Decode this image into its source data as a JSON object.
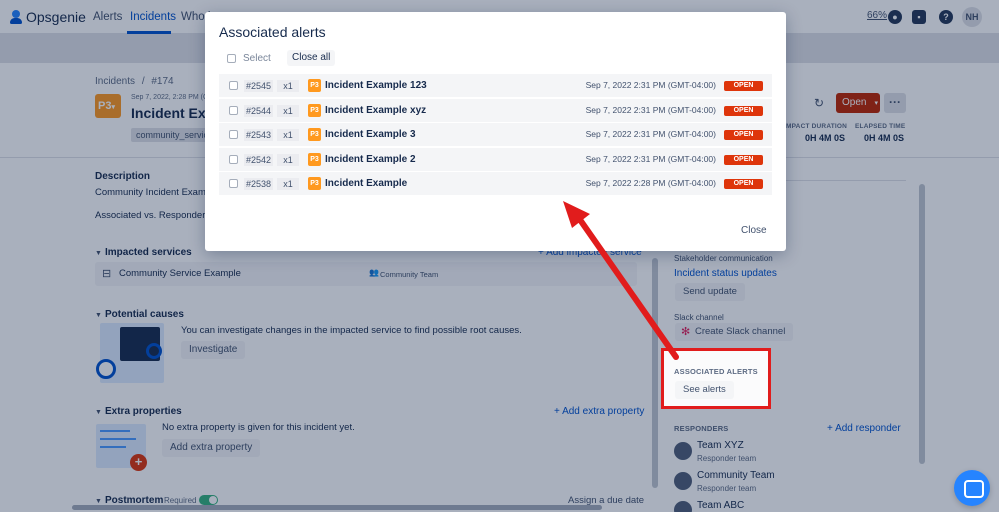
{
  "app": {
    "name": "Opsgenie",
    "nav": [
      "Alerts",
      "Incidents",
      "Who is"
    ],
    "zoom": "66%",
    "user_initials": "NH"
  },
  "incident": {
    "breadcrumbs": [
      "Incidents",
      "/",
      "#174"
    ],
    "priority": "P3",
    "date": "Sep 7, 2022, 2:28 PM (G",
    "title": "Incident Example",
    "service_tag": "community_servic",
    "status_button": "Open",
    "stats": {
      "impact_duration_label": "IMPACT DURATION",
      "impact_duration_value": "0H 4M 0S",
      "elapsed_time_label": "ELAPSED TIME",
      "elapsed_time_value": "0H 4M 0S"
    }
  },
  "main": {
    "description_heading": "Description",
    "description_text": "Community Incident Example",
    "associated_text": "Associated vs. Responder ale",
    "impacted_services": {
      "heading": "Impacted services",
      "add_label": "Add impacted service",
      "service_name": "Community Service Example",
      "team_name": "Community Team"
    },
    "potential_causes": {
      "heading": "Potential causes",
      "text": "You can investigate changes in the impacted service to find possible root causes.",
      "button": "Investigate"
    },
    "extra_properties": {
      "heading": "Extra properties",
      "add_label": "Add extra property",
      "text": "No extra property is given for this incident yet.",
      "button": "Add extra property"
    },
    "postmortem": {
      "heading": "Postmortem",
      "required_label": "Required",
      "due_label": "Assign a due date"
    }
  },
  "right_panel": {
    "stakeholder_label": "Stakeholder communication",
    "status_updates_link": "Incident status updates",
    "send_update_button": "Send update",
    "slack_label": "Slack channel",
    "create_slack_button": "Create Slack channel",
    "associated_alerts_heading": "ASSOCIATED ALERTS",
    "see_alerts_button": "See alerts",
    "responders_heading": "RESPONDERS",
    "add_responder_label": "Add responder",
    "responders": [
      {
        "name": "Team XYZ",
        "role": "Responder team"
      },
      {
        "name": "Community Team",
        "role": "Responder team"
      },
      {
        "name": "Team ABC",
        "role": ""
      }
    ]
  },
  "modal": {
    "title": "Associated alerts",
    "select_label": "Select",
    "close_all_button": "Close all",
    "close_button": "Close",
    "alerts": [
      {
        "id": "#2545",
        "count": "x1",
        "priority": "P3",
        "title": "Incident Example 123",
        "date": "Sep 7, 2022 2:31 PM (GMT-04:00)",
        "status": "OPEN"
      },
      {
        "id": "#2544",
        "count": "x1",
        "priority": "P3",
        "title": "Incident Example xyz",
        "date": "Sep 7, 2022 2:31 PM (GMT-04:00)",
        "status": "OPEN"
      },
      {
        "id": "#2543",
        "count": "x1",
        "priority": "P3",
        "title": "Incident Example 3",
        "date": "Sep 7, 2022 2:31 PM (GMT-04:00)",
        "status": "OPEN"
      },
      {
        "id": "#2542",
        "count": "x1",
        "priority": "P3",
        "title": "Incident Example 2",
        "date": "Sep 7, 2022 2:31 PM (GMT-04:00)",
        "status": "OPEN"
      },
      {
        "id": "#2538",
        "count": "x1",
        "priority": "P3",
        "title": "Incident Example",
        "date": "Sep 7, 2022 2:28 PM (GMT-04:00)",
        "status": "OPEN"
      }
    ]
  },
  "colors": {
    "accent": "#0052cc",
    "priority_p3": "#ff991f",
    "status_open": "#de350b",
    "annotation_red": "#e11c1c"
  }
}
